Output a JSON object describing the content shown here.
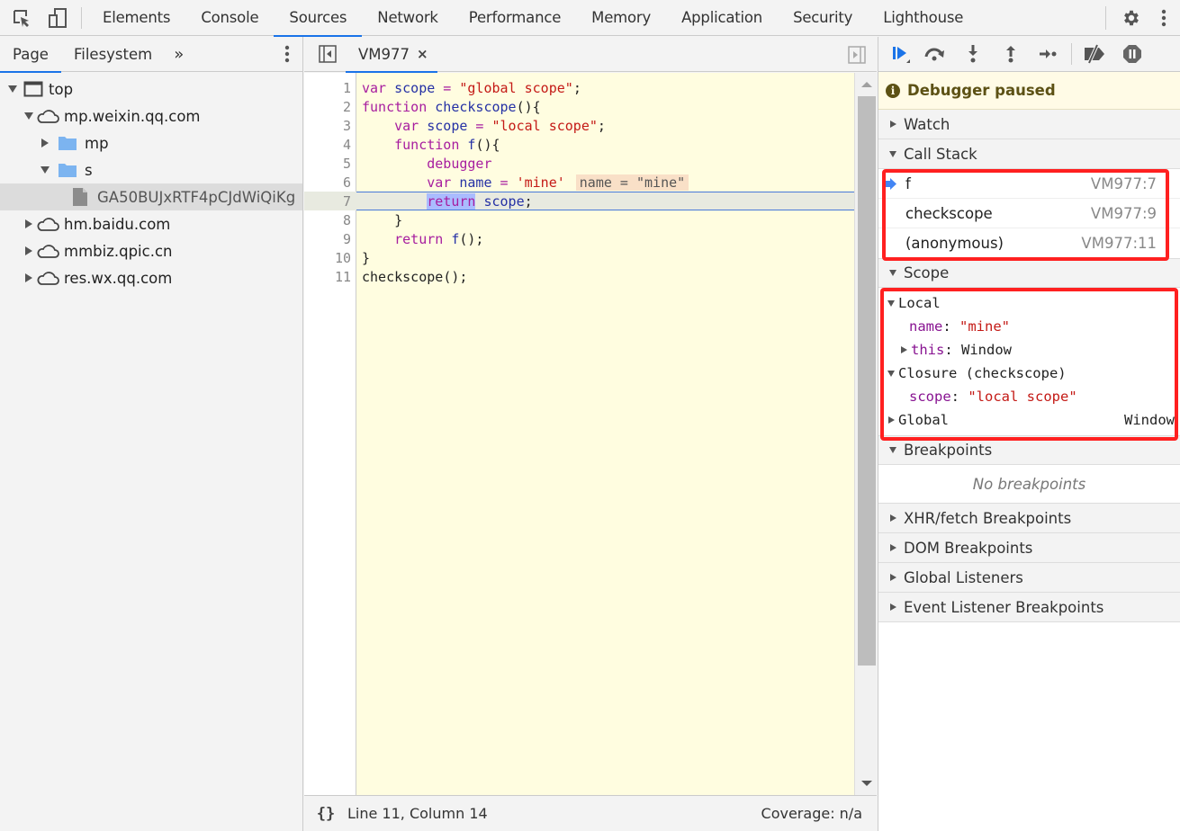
{
  "topbar": {
    "tabs": [
      {
        "label": "Elements"
      },
      {
        "label": "Console"
      },
      {
        "label": "Sources"
      },
      {
        "label": "Network"
      },
      {
        "label": "Performance"
      },
      {
        "label": "Memory"
      },
      {
        "label": "Application"
      },
      {
        "label": "Security"
      },
      {
        "label": "Lighthouse"
      }
    ],
    "active_tab": "Sources"
  },
  "navigator": {
    "tabs": [
      {
        "label": "Page"
      },
      {
        "label": "Filesystem"
      }
    ],
    "more_label": "»",
    "tree": [
      {
        "label": "top",
        "icon": "frame-icon",
        "expanded": true
      },
      {
        "label": "mp.weixin.qq.com",
        "icon": "cloud-icon",
        "expanded": true
      },
      {
        "label": "mp",
        "icon": "folder-icon",
        "expanded": false
      },
      {
        "label": "s",
        "icon": "folder-icon",
        "expanded": true
      },
      {
        "label": "GA50BUJxRTF4pCJdWiQiKg",
        "icon": "file-icon",
        "selected": true
      },
      {
        "label": "hm.baidu.com",
        "icon": "cloud-icon",
        "expanded": false
      },
      {
        "label": "mmbiz.qpic.cn",
        "icon": "cloud-icon",
        "expanded": false
      },
      {
        "label": "res.wx.qq.com",
        "icon": "cloud-icon",
        "expanded": false
      }
    ]
  },
  "editor": {
    "tab_label": "VM977",
    "close_label": "×",
    "line_numbers": [
      "1",
      "2",
      "3",
      "4",
      "5",
      "6",
      "7",
      "8",
      "9",
      "10",
      "11"
    ],
    "lines": {
      "l1": {
        "a": "var",
        "b": " scope",
        "c": " = ",
        "d": "\"global scope\"",
        "e": ";"
      },
      "l2": {
        "a": "function",
        "b": " checkscope",
        "c": "(){"
      },
      "l3": {
        "indent": "    ",
        "a": "var",
        "b": " scope",
        "c": " = ",
        "d": "\"local scope\"",
        "e": ";"
      },
      "l4": {
        "indent": "    ",
        "a": "function",
        "b": " f",
        "c": "(){"
      },
      "l5": {
        "indent": "        ",
        "a": "debugger"
      },
      "l6": {
        "indent": "        ",
        "a": "var",
        "b": " name",
        "c": " = ",
        "d": "'mine'",
        "inline": "name = \"mine\""
      },
      "l7": {
        "indent": "        ",
        "a": "return",
        "b": " scope",
        "c": ";"
      },
      "l8": {
        "indent": "    ",
        "a": "}"
      },
      "l9": {
        "indent": "    ",
        "a": "return",
        "b": " f",
        "c": "();"
      },
      "l10": {
        "a": "}"
      },
      "l11": {
        "a": "checkscope",
        "b": "();"
      }
    },
    "status": {
      "format_label": "{}",
      "position": "Line 11, Column 14",
      "coverage": "Coverage: n/a"
    }
  },
  "debugger": {
    "paused_label": "Debugger paused",
    "info_glyph": "i",
    "sections": {
      "watch": "Watch",
      "call_stack": "Call Stack",
      "scope": "Scope",
      "breakpoints": "Breakpoints",
      "xhr": "XHR/fetch Breakpoints",
      "dom": "DOM Breakpoints",
      "global_listeners": "Global Listeners",
      "event_listeners": "Event Listener Breakpoints"
    },
    "call_stack": [
      {
        "name": "f",
        "location": "VM977:7",
        "current": true
      },
      {
        "name": "checkscope",
        "location": "VM977:9"
      },
      {
        "name": "(anonymous)",
        "location": "VM977:11"
      }
    ],
    "scope": {
      "local_label": "Local",
      "local_name_key": "name",
      "local_name_val": "\"mine\"",
      "local_this_key": "this",
      "local_this_val": "Window",
      "closure_label": "Closure (checkscope)",
      "closure_scope_key": "scope",
      "closure_scope_val": "\"local scope\"",
      "global_label": "Global",
      "global_val": "Window",
      "colon": ": "
    },
    "no_breakpoints": "No breakpoints"
  },
  "colors": {
    "accent": "#1a73e8",
    "highlight_box": "#ff2020",
    "editor_bg": "#fffde0",
    "paused_bg": "#fffbe6"
  }
}
